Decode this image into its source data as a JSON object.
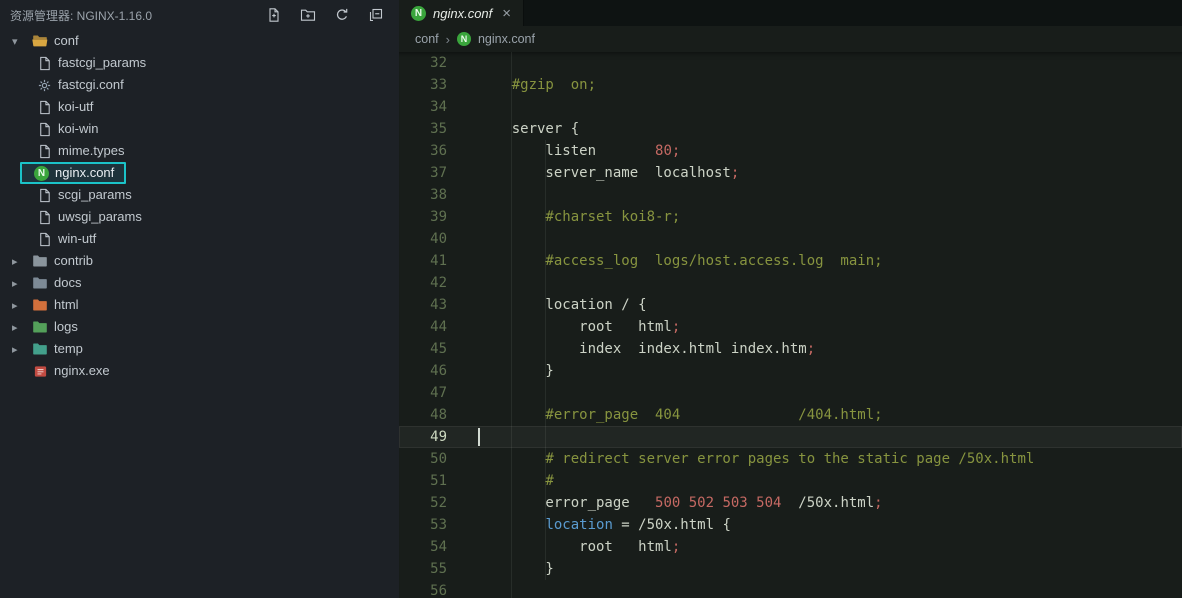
{
  "icons": {
    "chevron_down": "▾",
    "chevron_right": "▸",
    "close": "×",
    "breadcrumb_separator": "›",
    "nginx_badge": "N"
  },
  "palette": {
    "accent_teal": "#1bc3c8",
    "nginx_green": "#3aa53c",
    "editor_bg": "#181d1a",
    "sidebar_bg": "#1d2126",
    "tabbar_bg": "#0e1312",
    "comment": "#87943f",
    "plain": "#ccd3c6",
    "number": "#c56963",
    "keyword": "#5a9bd0",
    "line_number": "#5f7050",
    "line_number_active": "#cdd9c0"
  },
  "sidebar": {
    "title": "资源管理器: NGINX-1.16.0",
    "actions": [
      {
        "name": "new-file"
      },
      {
        "name": "new-folder"
      },
      {
        "name": "refresh"
      },
      {
        "name": "collapse-all"
      }
    ],
    "tree": [
      {
        "label": "conf",
        "kind": "folder",
        "level": 0,
        "expanded": true,
        "icon": "folder-open",
        "color": "#d9a741"
      },
      {
        "label": "fastcgi_params",
        "kind": "file",
        "level": 1,
        "icon": "file"
      },
      {
        "label": "fastcgi.conf",
        "kind": "file",
        "level": 1,
        "icon": "gear"
      },
      {
        "label": "koi-utf",
        "kind": "file",
        "level": 1,
        "icon": "file"
      },
      {
        "label": "koi-win",
        "kind": "file",
        "level": 1,
        "icon": "file"
      },
      {
        "label": "mime.types",
        "kind": "file",
        "level": 1,
        "icon": "file"
      },
      {
        "label": "nginx.conf",
        "kind": "file",
        "level": 1,
        "icon": "nginx",
        "selected": true
      },
      {
        "label": "scgi_params",
        "kind": "file",
        "level": 1,
        "icon": "file"
      },
      {
        "label": "uwsgi_params",
        "kind": "file",
        "level": 1,
        "icon": "file"
      },
      {
        "label": "win-utf",
        "kind": "file",
        "level": 1,
        "icon": "file"
      },
      {
        "label": "contrib",
        "kind": "folder",
        "level": 0,
        "expanded": false,
        "icon": "folder",
        "color": "#8a949c"
      },
      {
        "label": "docs",
        "kind": "folder",
        "level": 0,
        "expanded": false,
        "icon": "folder",
        "color": "#7d8a96"
      },
      {
        "label": "html",
        "kind": "folder",
        "level": 0,
        "expanded": false,
        "icon": "folder",
        "color": "#d2703c"
      },
      {
        "label": "logs",
        "kind": "folder",
        "level": 0,
        "expanded": false,
        "icon": "folder",
        "color": "#54a05a"
      },
      {
        "label": "temp",
        "kind": "folder",
        "level": 0,
        "expanded": false,
        "icon": "folder",
        "color": "#43a08b"
      },
      {
        "label": "nginx.exe",
        "kind": "file",
        "level": 0,
        "icon": "exe"
      }
    ]
  },
  "tabs": [
    {
      "label": "nginx.conf",
      "icon": "nginx",
      "active": true
    }
  ],
  "breadcrumb": [
    {
      "label": "conf"
    },
    {
      "label": "nginx.conf",
      "icon": "nginx"
    }
  ],
  "editor": {
    "first_line": 32,
    "cursor_line": 49,
    "lines": [
      {
        "n": 32,
        "s": []
      },
      {
        "n": 33,
        "s": [
          [
            "    #gzip  on;",
            "comment"
          ]
        ]
      },
      {
        "n": 34,
        "s": []
      },
      {
        "n": 35,
        "s": [
          [
            "    server {",
            "plain"
          ]
        ]
      },
      {
        "n": 36,
        "s": [
          [
            "        listen       ",
            "plain"
          ],
          [
            "80",
            "number"
          ],
          [
            ";",
            "punct"
          ]
        ]
      },
      {
        "n": 37,
        "s": [
          [
            "        server_name  localhost",
            "plain"
          ],
          [
            ";",
            "punct"
          ]
        ]
      },
      {
        "n": 38,
        "s": []
      },
      {
        "n": 39,
        "s": [
          [
            "        #charset koi8-r;",
            "comment"
          ]
        ]
      },
      {
        "n": 40,
        "s": []
      },
      {
        "n": 41,
        "s": [
          [
            "        #access_log  logs/host.access.log  main;",
            "comment"
          ]
        ]
      },
      {
        "n": 42,
        "s": []
      },
      {
        "n": 43,
        "s": [
          [
            "        location / {",
            "plain"
          ]
        ]
      },
      {
        "n": 44,
        "s": [
          [
            "            root   html",
            "plain"
          ],
          [
            ";",
            "punct"
          ]
        ]
      },
      {
        "n": 45,
        "s": [
          [
            "            index  index.html index.htm",
            "plain"
          ],
          [
            ";",
            "punct"
          ]
        ]
      },
      {
        "n": 46,
        "s": [
          [
            "        }",
            "plain"
          ]
        ]
      },
      {
        "n": 47,
        "s": []
      },
      {
        "n": 48,
        "s": [
          [
            "        #error_page  404              /404.html;",
            "comment"
          ]
        ]
      },
      {
        "n": 49,
        "s": []
      },
      {
        "n": 50,
        "s": [
          [
            "        # redirect server error pages to the static page /50x.html",
            "comment"
          ]
        ]
      },
      {
        "n": 51,
        "s": [
          [
            "        #",
            "comment"
          ]
        ]
      },
      {
        "n": 52,
        "s": [
          [
            "        error_page   ",
            "plain"
          ],
          [
            "500 502 503 504",
            "number"
          ],
          [
            "  /50x.html",
            "plain"
          ],
          [
            ";",
            "punct"
          ]
        ]
      },
      {
        "n": 53,
        "s": [
          [
            "        ",
            "plain"
          ],
          [
            "location",
            "keyword"
          ],
          [
            " = /50x.html {",
            "plain"
          ]
        ]
      },
      {
        "n": 54,
        "s": [
          [
            "            root   html",
            "plain"
          ],
          [
            ";",
            "punct"
          ]
        ]
      },
      {
        "n": 55,
        "s": [
          [
            "        }",
            "plain"
          ]
        ]
      },
      {
        "n": 56,
        "s": []
      }
    ]
  }
}
